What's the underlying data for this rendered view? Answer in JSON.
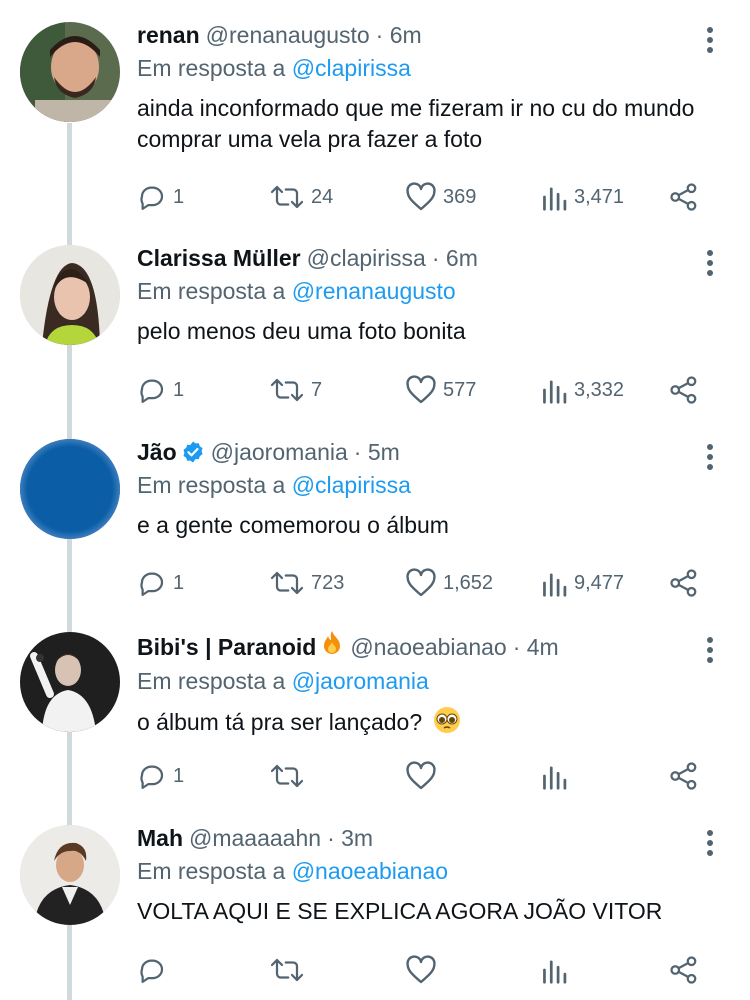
{
  "reply_prefix": "Em resposta a",
  "colors": {
    "accent": "#1d9bf0",
    "text": "#0f1419",
    "secondary": "#536471",
    "thread_line": "#cfd9de"
  },
  "tweets": [
    {
      "name": "renan",
      "handle": "@renanaugusto",
      "time": "· 6m",
      "reply_to": "@clapirissa",
      "text": "ainda inconformado que me fizeram ir no cu do mundo comprar uma vela pra fazer a foto",
      "replies": "1",
      "retweets": "24",
      "likes": "369",
      "views": "3,471"
    },
    {
      "name": "Clarissa Müller",
      "handle": "@clapirissa",
      "time": "· 6m",
      "reply_to": "@renanaugusto",
      "text": "pelo menos deu uma foto bonita",
      "replies": "1",
      "retweets": "7",
      "likes": "577",
      "views": "3,332"
    },
    {
      "name": "Jão",
      "handle": "@jaoromania",
      "time": "· 5m",
      "reply_to": "@clapirissa",
      "text": "e a gente comemorou o álbum",
      "replies": "1",
      "retweets": "723",
      "likes": "1,652",
      "views": "9,477",
      "verified": true
    },
    {
      "name": "Bibi's | Paranoid",
      "handle": "@naoeabianao",
      "time": "· 4m",
      "reply_to": "@jaoromania",
      "text": "o álbum tá pra ser lançado?",
      "replies": "1",
      "retweets": "",
      "likes": "",
      "views": "",
      "name_emoji": "fire-emoji",
      "text_emoji": "pleading-face-emoji"
    },
    {
      "name": "Mah",
      "handle": "@maaaaahn",
      "time": "· 3m",
      "reply_to": "@naoeabianao",
      "text": "VOLTA AQUI E SE EXPLICA AGORA JOÃO VITOR",
      "replies": "",
      "retweets": "",
      "likes": "",
      "views": ""
    }
  ]
}
